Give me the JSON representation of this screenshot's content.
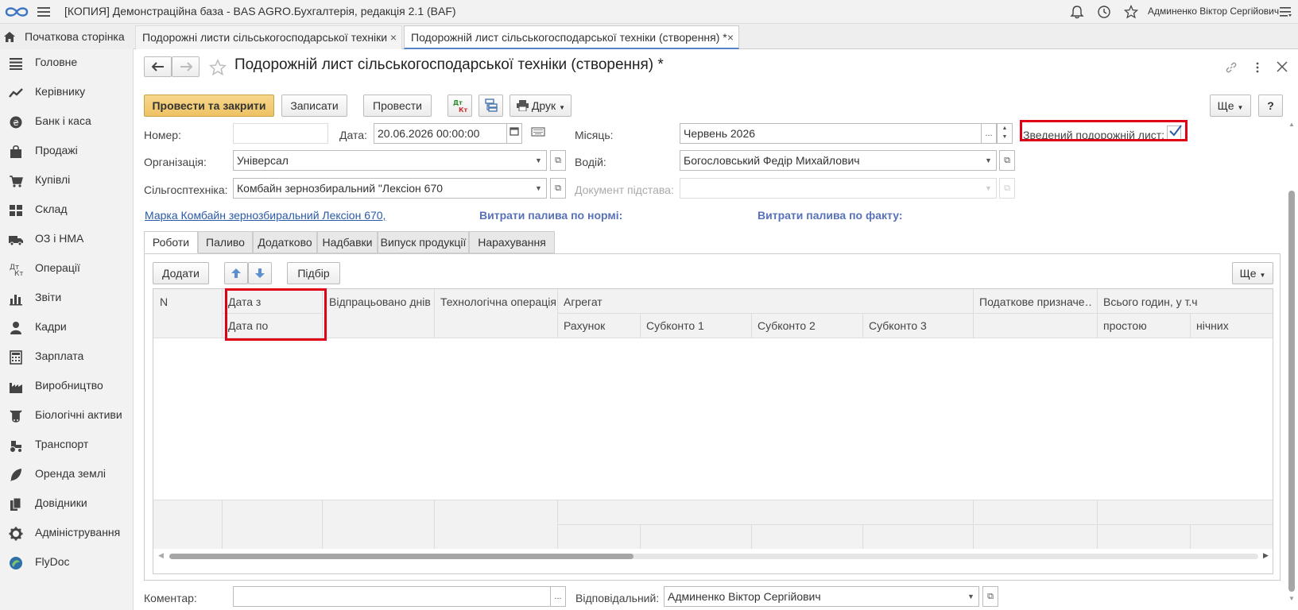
{
  "app": {
    "title": "[КОПИЯ] Демонстраційна база - BAS AGRO.Бухгалтерія, редакція 2.1  (BAF)",
    "user": "Админенко Віктор Сергійович"
  },
  "tabs": {
    "home": "Початкова сторінка",
    "list": "Подорожні листи сільськогосподарської техніки",
    "current": "Подорожній лист сільськогосподарської техніки (створення) *",
    "close": "×"
  },
  "sidebar": {
    "items": [
      {
        "label": "Головне",
        "icon": "menu-lines-icon"
      },
      {
        "label": "Керівнику",
        "icon": "trend-icon"
      },
      {
        "label": "Банк і каса",
        "icon": "coin-icon"
      },
      {
        "label": "Продажі",
        "icon": "bag-icon"
      },
      {
        "label": "Купівлі",
        "icon": "cart-icon"
      },
      {
        "label": "Склад",
        "icon": "warehouse-icon"
      },
      {
        "label": "ОЗ і НМА",
        "icon": "truck-icon"
      },
      {
        "label": "Операції",
        "icon": "operations-icon"
      },
      {
        "label": "Звіти",
        "icon": "bar-chart-icon"
      },
      {
        "label": "Кадри",
        "icon": "person-icon"
      },
      {
        "label": "Зарплата",
        "icon": "calculator-icon"
      },
      {
        "label": "Виробництво",
        "icon": "factory-icon"
      },
      {
        "label": "Біологічні активи",
        "icon": "cow-icon"
      },
      {
        "label": "Транспорт",
        "icon": "tractor-icon"
      },
      {
        "label": "Оренда землі",
        "icon": "feather-icon"
      },
      {
        "label": "Довідники",
        "icon": "books-icon"
      },
      {
        "label": "Адміністрування",
        "icon": "gear-icon"
      },
      {
        "label": "FlyDoc",
        "icon": "flydoc-icon"
      }
    ]
  },
  "form": {
    "title": "Подорожній лист сільськогосподарської техніки (створення) *",
    "toolbar": {
      "post_close": "Провести та закрити",
      "save": "Записати",
      "post": "Провести",
      "print": "Друк",
      "more": "Ще",
      "help": "?"
    },
    "number_label": "Номер:",
    "number_value": "",
    "date_label": "Дата:",
    "date_value": "20.06.2026 00:00:00",
    "month_label": "Місяць:",
    "month_value": "Червень 2026",
    "summary_label": "Зведений подорожній лист:",
    "summary_checked": true,
    "org_label": "Організація:",
    "org_value": "Універсал",
    "driver_label": "Водій:",
    "driver_value": "Богословський Федір Михайлович",
    "machine_label": "Сільгосптехніка:",
    "machine_value": "Комбайн зернозбиральний \"Лексіон 670",
    "basis_label": "Документ підстава:",
    "basis_value": "",
    "brand_link": "Марка Комбайн зернозбиральний Лексіон 670, ",
    "fuel_norm": "Витрати палива по нормі:",
    "fuel_fact": "Витрати палива по факту:",
    "ellipsis": "...",
    "tabs": [
      "Роботи",
      "Паливо",
      "Додатково",
      "Надбавки",
      "Випуск продукції",
      "Нарахування"
    ],
    "table_toolbar": {
      "add": "Додати",
      "select": "Підбір",
      "more": "Ще"
    },
    "columns": {
      "n": "N",
      "date_from": "Дата з",
      "date_to": "Дата по",
      "days": "Відпрацьовано днів",
      "operation": "Технологічна операція",
      "aggregate": "Агрегат",
      "account": "Рахунок",
      "sub1": "Субконто 1",
      "sub2": "Субконто 2",
      "sub3": "Субконто 3",
      "tax": "Податкове призначе…",
      "hours": "Всього годин, у т.ч",
      "idle": "простою",
      "night": "нічних"
    },
    "comment_label": "Коментар:",
    "comment_value": "",
    "responsible_label": "Відповідальний:",
    "responsible_value": "Админенко Віктор Сергійович"
  },
  "colors": {
    "primary_button": "#eec264",
    "highlight": "#e00016",
    "link": "#2a5aa8",
    "bold_blue": "#5872b8"
  }
}
